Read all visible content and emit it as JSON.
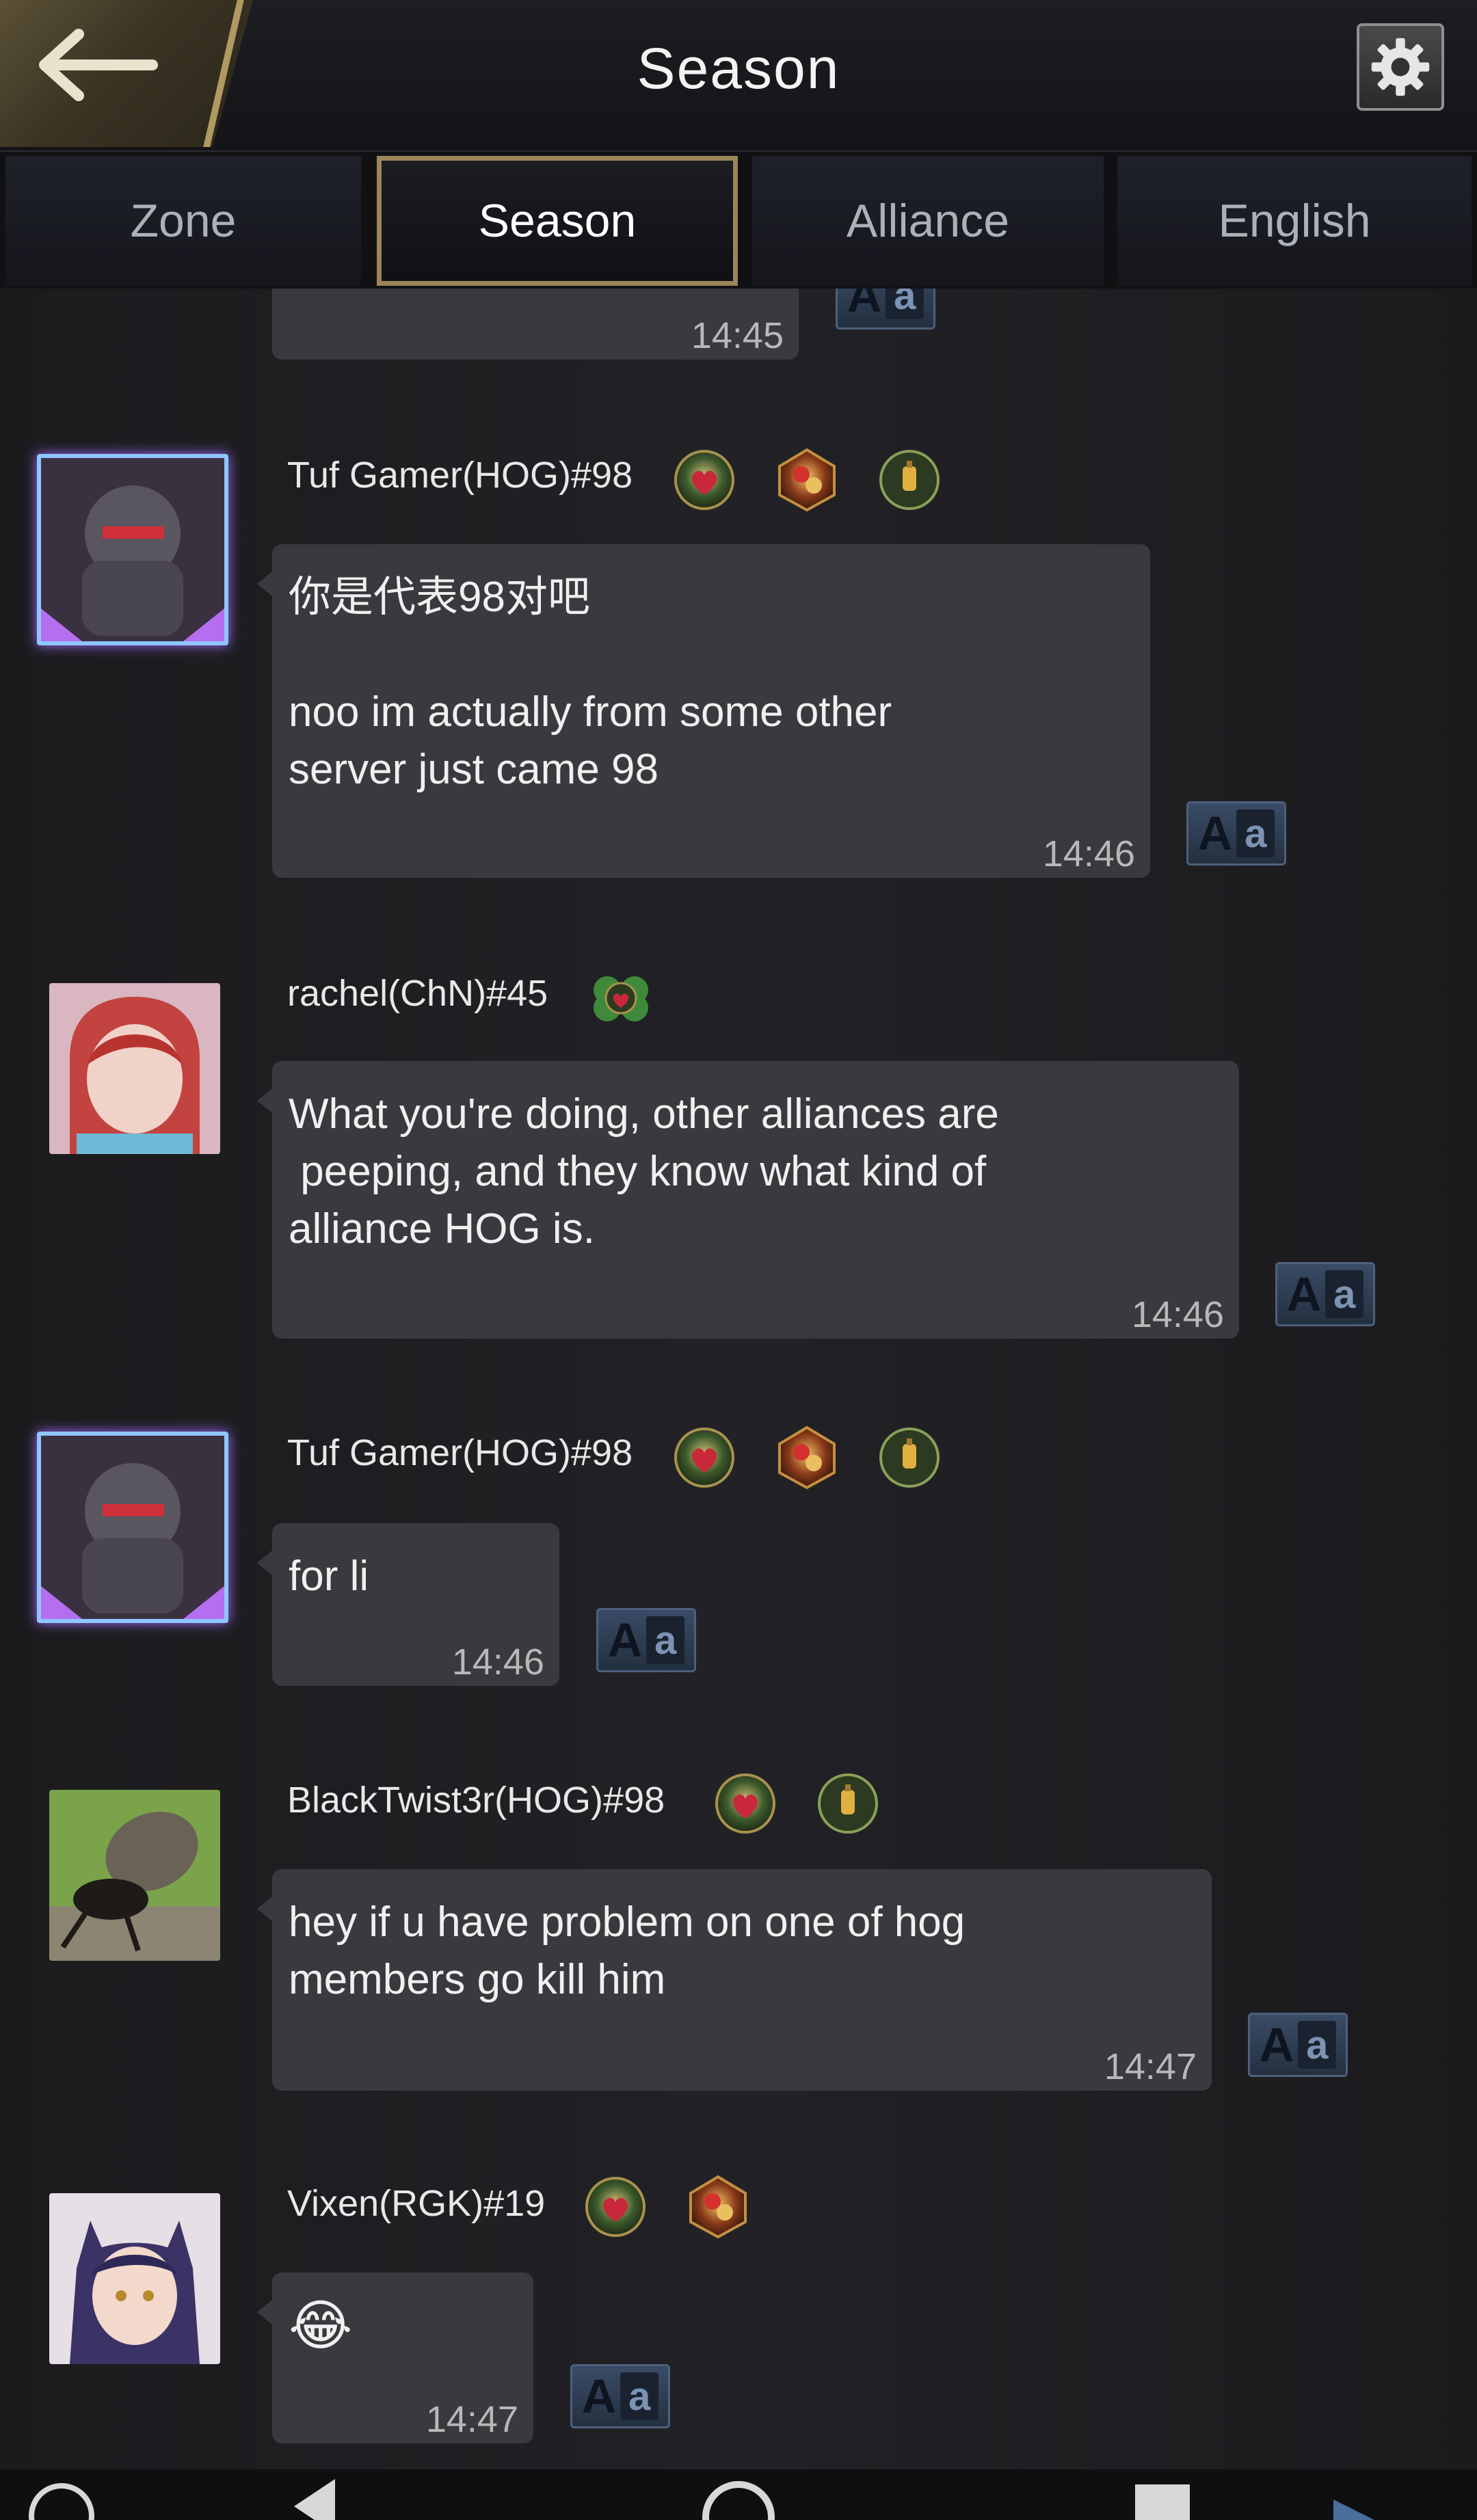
{
  "header": {
    "title": "Season"
  },
  "tabs": [
    {
      "label": "Zone",
      "active": false
    },
    {
      "label": "Season",
      "active": true
    },
    {
      "label": "Alliance",
      "active": false
    },
    {
      "label": "English",
      "active": false
    }
  ],
  "translate": {
    "big": "A",
    "small": "a"
  },
  "messages": [
    {
      "time": "14:45"
    },
    {
      "username": "Tuf Gamer(HOG)#98",
      "text": "你是代表98对吧\n\nnoo im actually from some other\nserver just came 98",
      "time": "14:46",
      "badges": [
        "heart-emblem-icon",
        "rose-lantern-icon",
        "lantern-emblem-icon"
      ]
    },
    {
      "username": "rachel(ChN)#45",
      "text": "What you're doing, other alliances are\n peeping, and they know what kind of\nalliance HOG is.",
      "time": "14:46",
      "badges": [
        "clover-heart-icon"
      ]
    },
    {
      "username": "Tuf Gamer(HOG)#98",
      "text": "for li",
      "time": "14:46",
      "badges": [
        "heart-emblem-icon",
        "rose-lantern-icon",
        "lantern-emblem-icon"
      ]
    },
    {
      "username": "BlackTwist3r(HOG)#98",
      "text": "hey if u have problem on one of hog\nmembers go kill him",
      "time": "14:47",
      "badges": [
        "heart-emblem-icon",
        "lantern-emblem-icon"
      ]
    },
    {
      "username": "Vixen(RGK)#19",
      "text": "😂",
      "time": "14:47",
      "badges": [
        "heart-emblem-icon",
        "rose-lantern-icon"
      ]
    }
  ],
  "colors": {
    "accent_gold": "#9b855a",
    "bubble": "#383a3e",
    "background": "#1a1a1d"
  }
}
